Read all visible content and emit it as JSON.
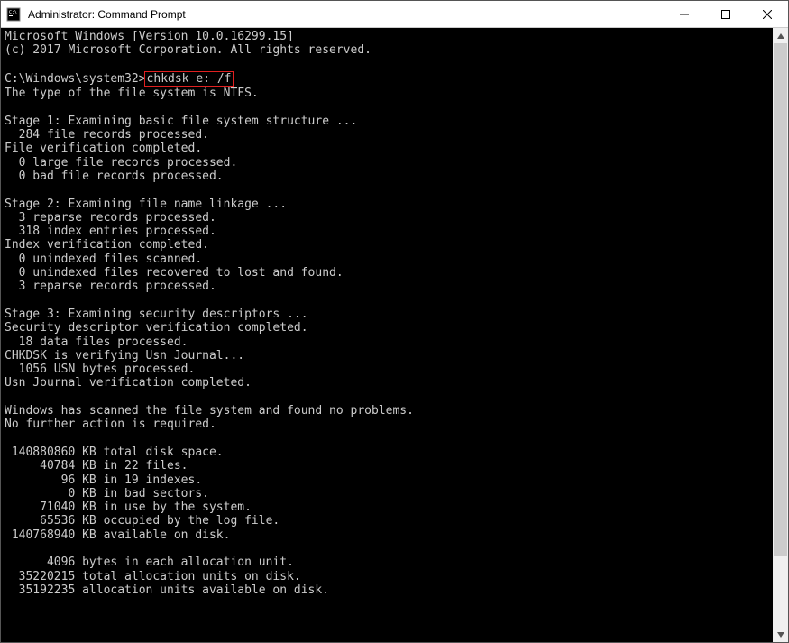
{
  "window": {
    "title": "Administrator: Command Prompt"
  },
  "prompt": {
    "path": "C:\\Windows\\system32>",
    "command": "chkdsk e: /f"
  },
  "lines_pre": [
    "Microsoft Windows [Version 10.0.16299.15]",
    "(c) 2017 Microsoft Corporation. All rights reserved.",
    ""
  ],
  "lines_post": [
    "The type of the file system is NTFS.",
    "",
    "Stage 1: Examining basic file system structure ...",
    "  284 file records processed.",
    "File verification completed.",
    "  0 large file records processed.",
    "  0 bad file records processed.",
    "",
    "Stage 2: Examining file name linkage ...",
    "  3 reparse records processed.",
    "  318 index entries processed.",
    "Index verification completed.",
    "  0 unindexed files scanned.",
    "  0 unindexed files recovered to lost and found.",
    "  3 reparse records processed.",
    "",
    "Stage 3: Examining security descriptors ...",
    "Security descriptor verification completed.",
    "  18 data files processed.",
    "CHKDSK is verifying Usn Journal...",
    "  1056 USN bytes processed.",
    "Usn Journal verification completed.",
    "",
    "Windows has scanned the file system and found no problems.",
    "No further action is required.",
    "",
    " 140880860 KB total disk space.",
    "     40784 KB in 22 files.",
    "        96 KB in 19 indexes.",
    "         0 KB in bad sectors.",
    "     71040 KB in use by the system.",
    "     65536 KB occupied by the log file.",
    " 140768940 KB available on disk.",
    "",
    "      4096 bytes in each allocation unit.",
    "  35220215 total allocation units on disk.",
    "  35192235 allocation units available on disk."
  ],
  "scroll": {
    "thumb_top_pct": 0,
    "thumb_height_pct": 88
  }
}
